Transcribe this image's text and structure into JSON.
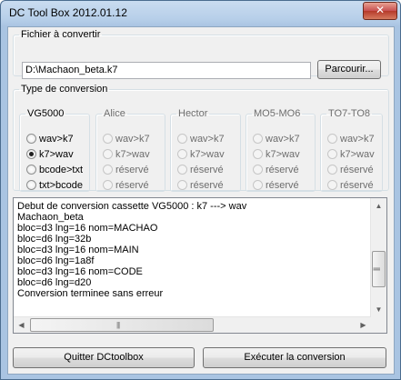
{
  "window": {
    "title": "DC Tool Box 2012.01.12",
    "close_glyph": "✕"
  },
  "file_group": {
    "legend": "Fichier à convertir",
    "path_value": "D:\\Machaon_beta.k7",
    "browse_label": "Parcourir..."
  },
  "conversion_group": {
    "legend": "Type de conversion",
    "systems": [
      {
        "name": "VG5000",
        "enabled": true,
        "options": [
          {
            "label": "wav>k7",
            "checked": false
          },
          {
            "label": "k7>wav",
            "checked": true
          },
          {
            "label": "bcode>txt",
            "checked": false
          },
          {
            "label": "txt>bcode",
            "checked": false
          }
        ]
      },
      {
        "name": "Alice",
        "enabled": false,
        "options": [
          {
            "label": "wav>k7",
            "checked": false
          },
          {
            "label": "k7>wav",
            "checked": false
          },
          {
            "label": "réservé",
            "checked": false
          },
          {
            "label": "réservé",
            "checked": false
          }
        ]
      },
      {
        "name": "Hector",
        "enabled": false,
        "options": [
          {
            "label": "wav>k7",
            "checked": false
          },
          {
            "label": "k7>wav",
            "checked": false
          },
          {
            "label": "réservé",
            "checked": false
          },
          {
            "label": "réservé",
            "checked": false
          }
        ]
      },
      {
        "name": "MO5-MO6",
        "enabled": false,
        "options": [
          {
            "label": "wav>k7",
            "checked": false
          },
          {
            "label": "k7>wav",
            "checked": false
          },
          {
            "label": "réservé",
            "checked": false
          },
          {
            "label": "réservé",
            "checked": false
          }
        ]
      },
      {
        "name": "TO7-TO8",
        "enabled": false,
        "options": [
          {
            "label": "wav>k7",
            "checked": false
          },
          {
            "label": "k7>wav",
            "checked": false
          },
          {
            "label": "réservé",
            "checked": false
          },
          {
            "label": "réservé",
            "checked": false
          }
        ]
      }
    ]
  },
  "log": {
    "lines": [
      "Debut de conversion cassette VG5000 : k7 ---> wav",
      "Machaon_beta",
      "bloc=d3 lng=16 nom=MACHAO",
      "bloc=d6 lng=32b",
      "bloc=d3 lng=16 nom=MAIN",
      "bloc=d6 lng=1a8f",
      "bloc=d3 lng=16 nom=CODE",
      "bloc=d6 lng=d20",
      "Conversion terminee sans erreur"
    ]
  },
  "actions": {
    "quit_label": "Quitter DCtoolbox",
    "run_label": "Exécuter la conversion"
  },
  "icons": {
    "scroll_up": "▲",
    "scroll_down": "▼",
    "scroll_left": "◀",
    "scroll_right": "▶",
    "grip": "|||"
  },
  "colors": {
    "window_frame": "#a9c4e2",
    "close_button": "#c75050",
    "client_bg": "#f0f0f0"
  }
}
